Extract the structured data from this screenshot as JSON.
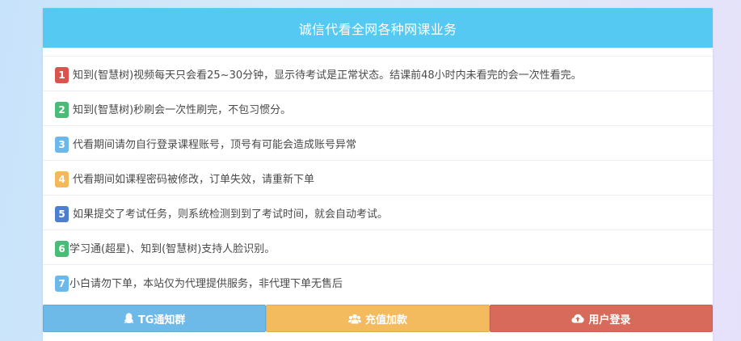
{
  "header": {
    "title": "诚信代看全网各种网课业务"
  },
  "notices": [
    {
      "num": "1",
      "color": "#d9534f",
      "text": "知到(智慧树)视频每天只会看25~30分钟，显示待考试是正常状态。结课前48小时内未看完的会一次性看完。"
    },
    {
      "num": "2",
      "color": "#4cbb7a",
      "text": "知到(智慧树)秒刷会一次性刷完，不包习惯分。"
    },
    {
      "num": "3",
      "color": "#6cb8ea",
      "text": "代看期间请勿自行登录课程账号，顶号有可能会造成账号异常"
    },
    {
      "num": "4",
      "color": "#f4b75a",
      "text": "代看期间如课程密码被修改，订单失效，请重新下单"
    },
    {
      "num": "5",
      "color": "#4e7fcf",
      "text": "如果提交了考试任务，则系统检测到到了考试时间，就会自动考试。"
    },
    {
      "num": "6",
      "color": "#4cbb7a",
      "text": "学习通(超星)、知到(智慧树)支持人脸识别。"
    },
    {
      "num": "7",
      "color": "#6cb8ea",
      "text": "小白请勿下单，本站仅为代理提供服务，非代理下单无售后"
    }
  ],
  "buttons": {
    "tg": {
      "label": "TG通知群",
      "color": "#6db9e8",
      "icon": "qq-icon"
    },
    "recharge": {
      "label": "充值加款",
      "color": "#f3ba5e",
      "icon": "users-icon"
    },
    "login": {
      "label": "用户登录",
      "color": "#d86a5c",
      "icon": "cloud-upload-icon"
    }
  }
}
